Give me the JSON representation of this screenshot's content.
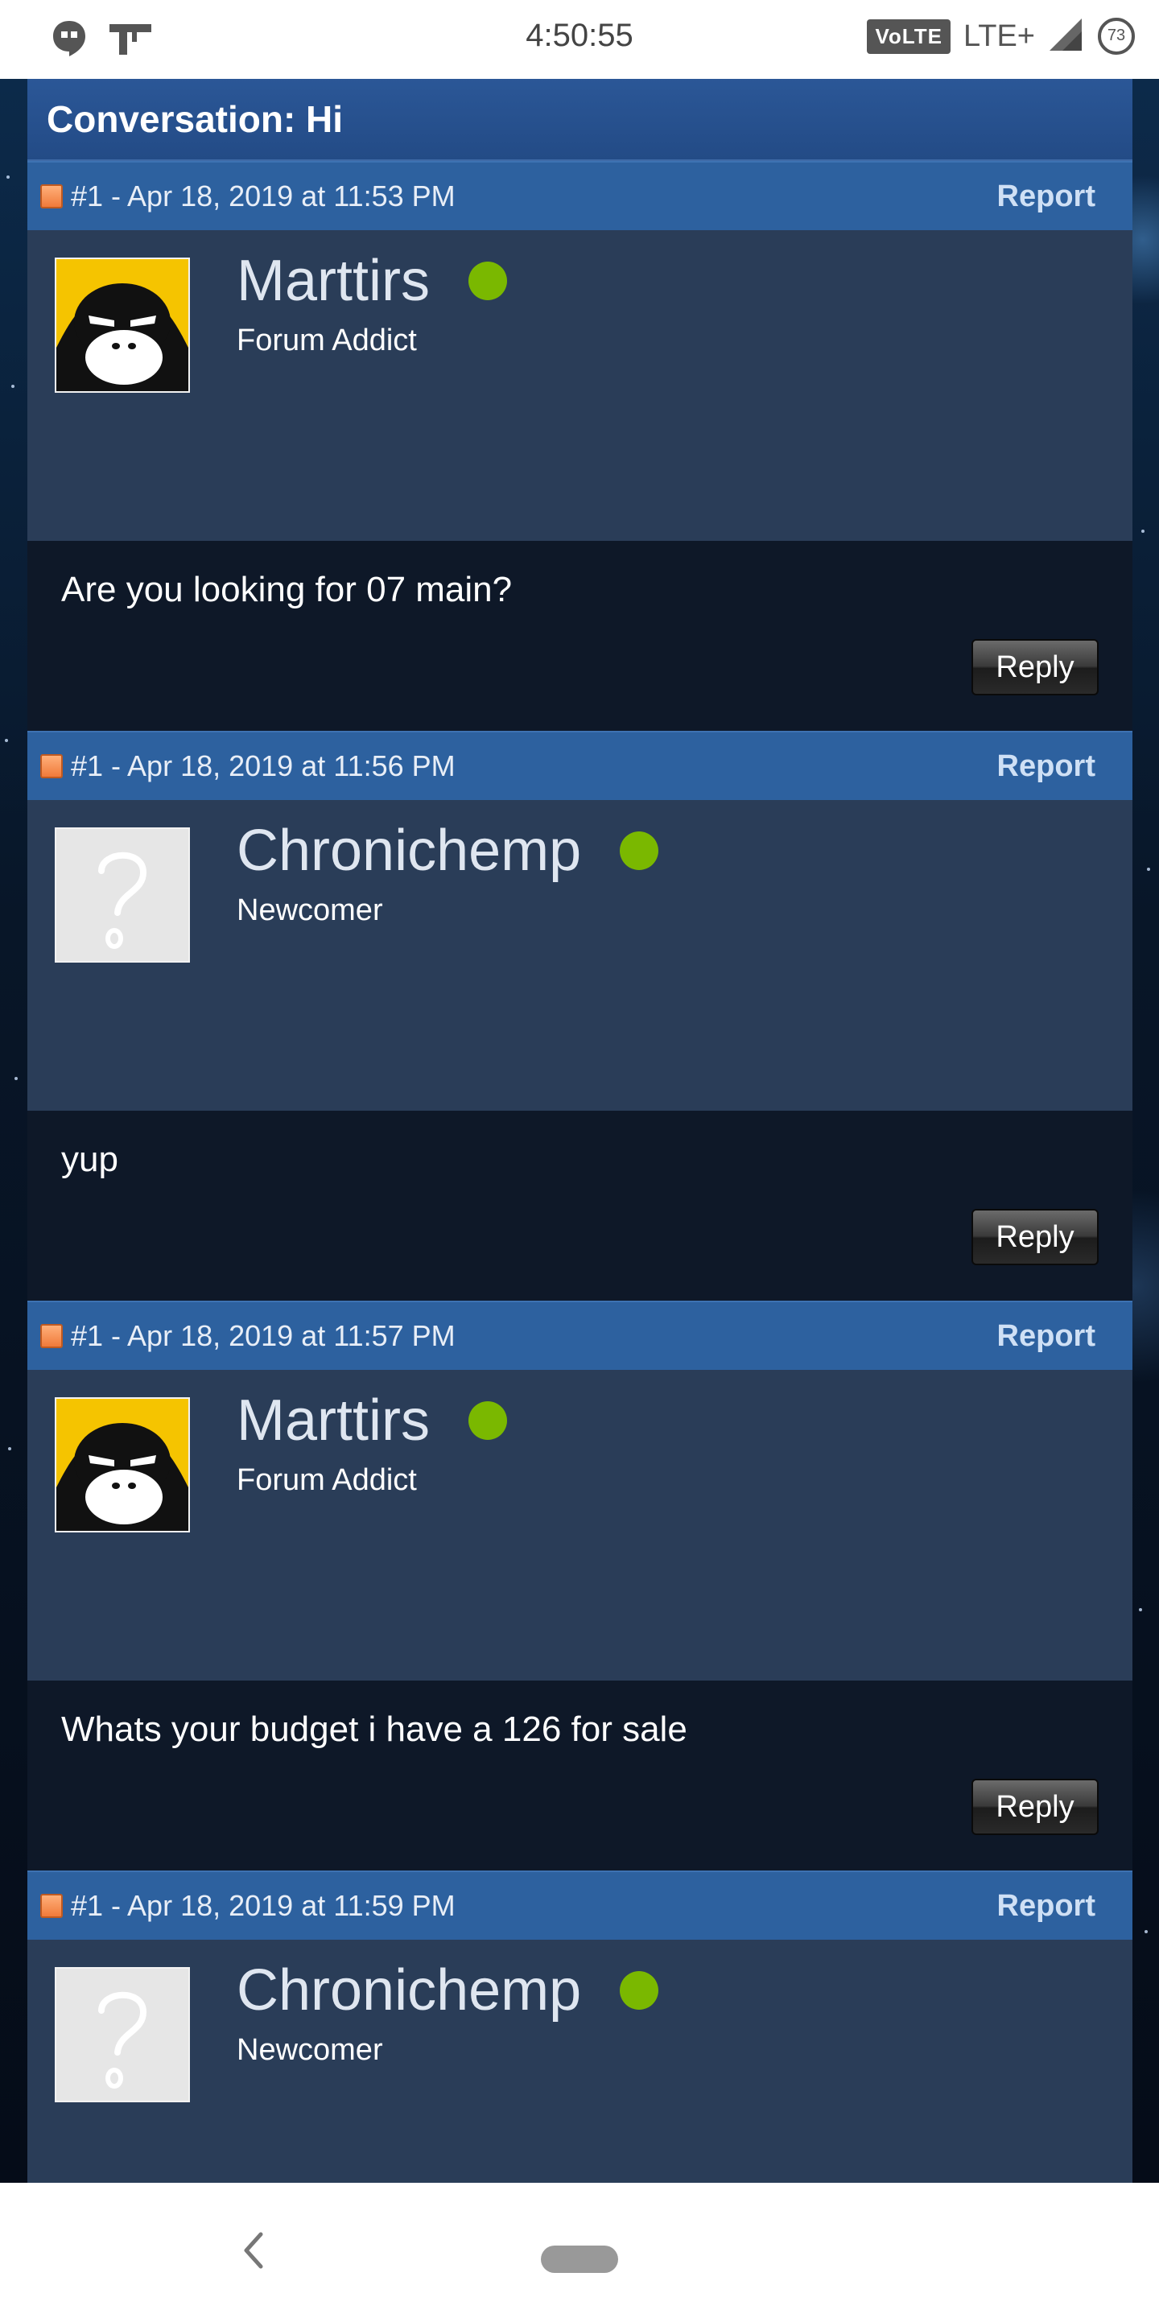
{
  "status_bar": {
    "time": "4:50:55",
    "volte": "VoLTE",
    "network": "LTE+",
    "battery": "73",
    "icons": [
      "hangouts-icon",
      "gun-icon",
      "signal-icon",
      "battery-icon"
    ]
  },
  "conversation": {
    "title": "Conversation: Hi"
  },
  "posts": [
    {
      "meta": "#1 - Apr 18, 2019 at 11:53 PM",
      "report_label": "Report",
      "username": "Marttirs",
      "user_title": "Forum Addict",
      "avatar": "gorilla-avatar",
      "online": true,
      "message": "Are you looking for 07 main?",
      "reply_label": "Reply"
    },
    {
      "meta": "#1 - Apr 18, 2019 at 11:56 PM",
      "report_label": "Report",
      "username": "Chronichemp",
      "user_title": "Newcomer",
      "avatar": "question-mark-avatar",
      "online": true,
      "message": "yup",
      "reply_label": "Reply"
    },
    {
      "meta": "#1 - Apr 18, 2019 at 11:57 PM",
      "report_label": "Report",
      "username": "Marttirs",
      "user_title": "Forum Addict",
      "avatar": "gorilla-avatar",
      "online": true,
      "message": "Whats your budget i have a 126 for sale",
      "reply_label": "Reply"
    },
    {
      "meta": "#1 - Apr 18, 2019 at 11:59 PM",
      "report_label": "Report",
      "username": "Chronichemp",
      "user_title": "Newcomer",
      "avatar": "question-mark-avatar",
      "online": true
    }
  ],
  "colors": {
    "header_blue": "#2d619f",
    "post_bg": "#2a3d58",
    "body_bg": "#0e1828",
    "online_green": "#7ab800"
  }
}
